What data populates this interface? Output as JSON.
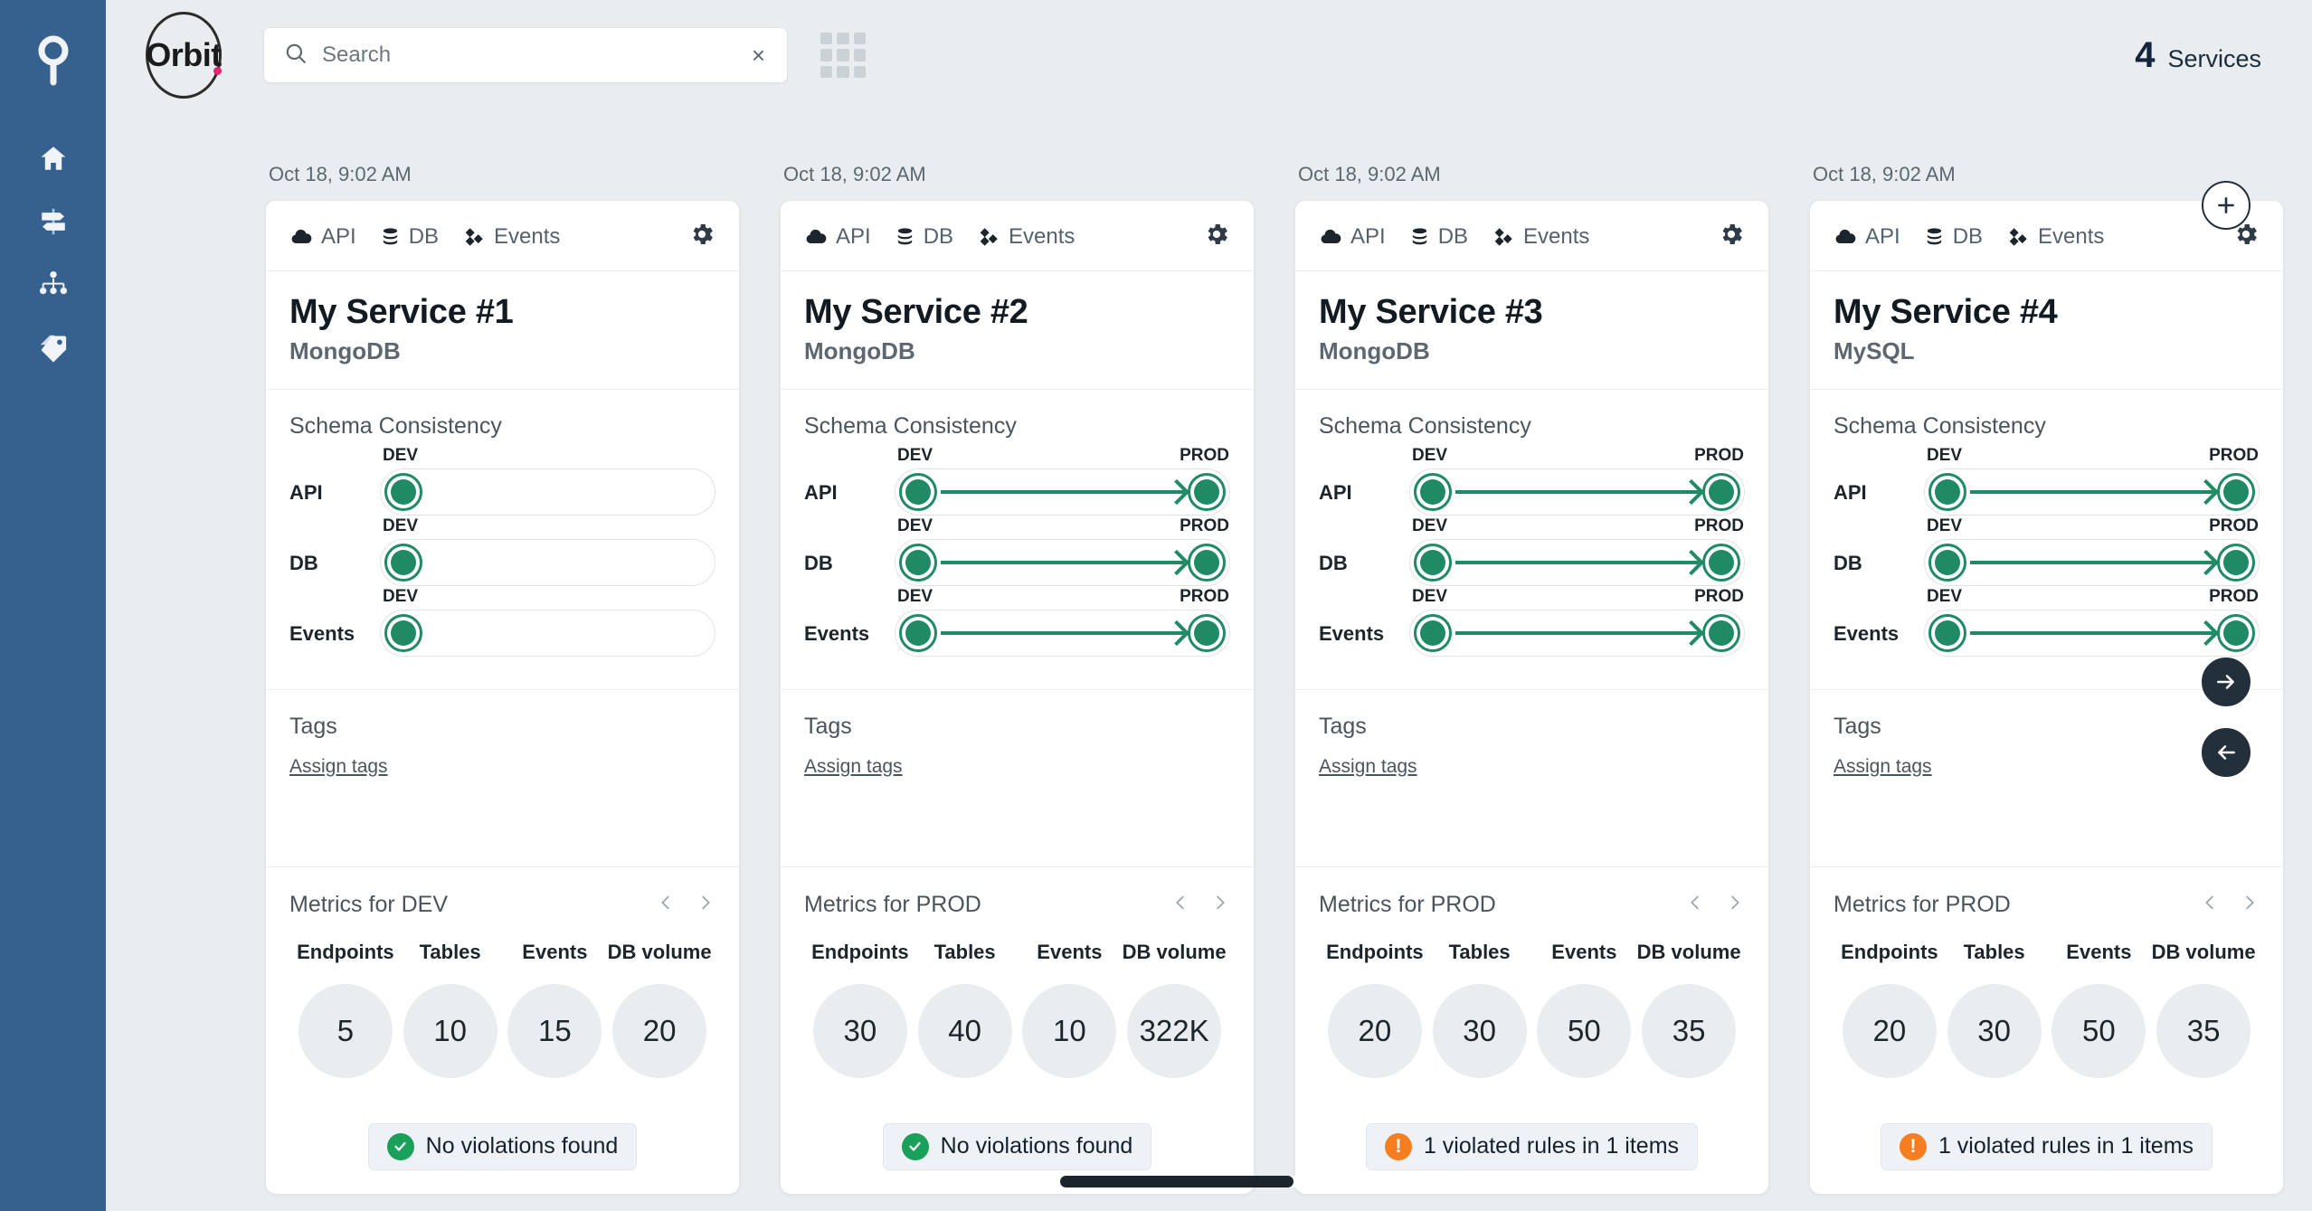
{
  "sidebar": {
    "logo_icon": "orbit-9-logo-icon",
    "items": [
      {
        "name": "home",
        "icon": "home-icon"
      },
      {
        "name": "flows",
        "icon": "signpost-icon"
      },
      {
        "name": "hierarchy",
        "icon": "sitemap-icon"
      },
      {
        "name": "tags",
        "icon": "tag-icon"
      }
    ]
  },
  "topbar": {
    "brand_word": "Orbit",
    "search": {
      "placeholder": "Search",
      "value": "",
      "clear_label": "×"
    },
    "grid_toggle_icon": "grid-view-icon",
    "services": {
      "count": "4",
      "label": "Services"
    }
  },
  "rail": {
    "add_label": "+",
    "next_label": "→",
    "prev_label": "←"
  },
  "common": {
    "chips": [
      {
        "label": "API",
        "icon": "cloud-icon"
      },
      {
        "label": "DB",
        "icon": "database-icon"
      },
      {
        "label": "Events",
        "icon": "events-diamond-icon"
      }
    ],
    "gear_icon": "gear-icon",
    "schema_section_title": "Schema Consistency",
    "tags_title": "Tags",
    "assign_tags_label": "Assign tags",
    "metric_names": [
      "Endpoints",
      "Tables",
      "Events",
      "DB volume"
    ],
    "schema_rows": [
      "API",
      "DB",
      "Events"
    ],
    "env_left": "DEV",
    "env_right": "PROD"
  },
  "cards": [
    {
      "date": "Oct 18, 9:02 AM",
      "title": "My Service #1",
      "subtitle": "MongoDB",
      "schema": [
        {
          "label": "API",
          "left_env": "DEV",
          "right_env": "",
          "connected": false
        },
        {
          "label": "DB",
          "left_env": "DEV",
          "right_env": "",
          "connected": false
        },
        {
          "label": "Events",
          "left_env": "DEV",
          "right_env": "",
          "connected": false
        }
      ],
      "metrics_title": "Metrics for DEV",
      "metrics": [
        {
          "name": "Endpoints",
          "value": "5"
        },
        {
          "name": "Tables",
          "value": "10"
        },
        {
          "name": "Events",
          "value": "15"
        },
        {
          "name": "DB volume",
          "value": "20"
        }
      ],
      "violation": {
        "text": "No violations found",
        "status": "ok"
      }
    },
    {
      "date": "Oct 18, 9:02 AM",
      "title": "My Service #2",
      "subtitle": "MongoDB",
      "schema": [
        {
          "label": "API",
          "left_env": "DEV",
          "right_env": "PROD",
          "connected": true
        },
        {
          "label": "DB",
          "left_env": "DEV",
          "right_env": "PROD",
          "connected": true
        },
        {
          "label": "Events",
          "left_env": "DEV",
          "right_env": "PROD",
          "connected": true
        }
      ],
      "metrics_title": "Metrics for PROD",
      "metrics": [
        {
          "name": "Endpoints",
          "value": "30"
        },
        {
          "name": "Tables",
          "value": "40"
        },
        {
          "name": "Events",
          "value": "10"
        },
        {
          "name": "DB volume",
          "value": "322K"
        }
      ],
      "violation": {
        "text": "No violations found",
        "status": "ok"
      }
    },
    {
      "date": "Oct 18, 9:02 AM",
      "title": "My Service #3",
      "subtitle": "MongoDB",
      "schema": [
        {
          "label": "API",
          "left_env": "DEV",
          "right_env": "PROD",
          "connected": true
        },
        {
          "label": "DB",
          "left_env": "DEV",
          "right_env": "PROD",
          "connected": true
        },
        {
          "label": "Events",
          "left_env": "DEV",
          "right_env": "PROD",
          "connected": true
        }
      ],
      "metrics_title": "Metrics for PROD",
      "metrics": [
        {
          "name": "Endpoints",
          "value": "20"
        },
        {
          "name": "Tables",
          "value": "30"
        },
        {
          "name": "Events",
          "value": "50"
        },
        {
          "name": "DB volume",
          "value": "35"
        }
      ],
      "violation": {
        "text": "1 violated rules in 1 items",
        "status": "warn"
      }
    },
    {
      "date": "Oct 18, 9:02 AM",
      "title": "My Service #4",
      "subtitle": "MySQL",
      "schema": [
        {
          "label": "API",
          "left_env": "DEV",
          "right_env": "PROD",
          "connected": true
        },
        {
          "label": "DB",
          "left_env": "DEV",
          "right_env": "PROD",
          "connected": true
        },
        {
          "label": "Events",
          "left_env": "DEV",
          "right_env": "PROD",
          "connected": true
        }
      ],
      "metrics_title": "Metrics for PROD",
      "metrics": [
        {
          "name": "Endpoints",
          "value": "20"
        },
        {
          "name": "Tables",
          "value": "30"
        },
        {
          "name": "Events",
          "value": "50"
        },
        {
          "name": "DB volume",
          "value": "35"
        }
      ],
      "violation": {
        "text": "1 violated rules in 1 items",
        "status": "warn"
      }
    }
  ],
  "colors": {
    "sidebar": "#36618e",
    "accent_green": "#1f8a63",
    "warn_orange": "#f57f20",
    "ok_green": "#19a05a",
    "brand_dot": "#e8246e"
  }
}
